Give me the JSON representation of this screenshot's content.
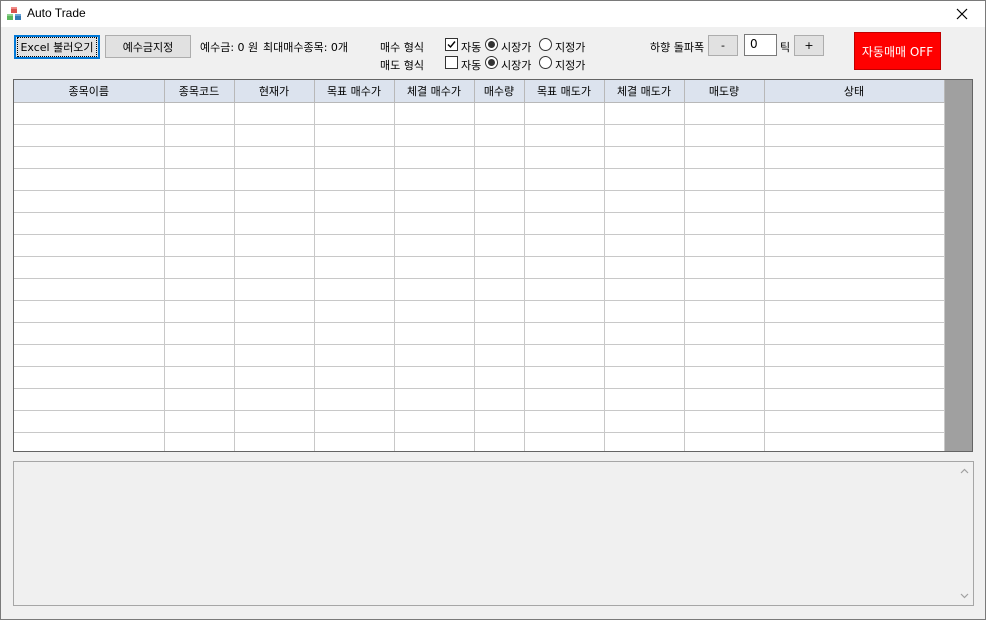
{
  "window": {
    "title": "Auto Trade",
    "app_icon": "cubes-icon",
    "close_icon": "close-icon"
  },
  "toolbar": {
    "excel_load_label": "Excel 불러오기",
    "deposit_set_label": "예수금지정",
    "deposit_info": "예수금: 0 원",
    "max_stocks_info": "최대매수종목: 0개",
    "buy_type_label": "매수 형식",
    "sell_type_label": "매도 형식",
    "auto_label": "자동",
    "market_price_label": "시장가",
    "limit_price_label": "지정가",
    "buy_auto_checked": true,
    "sell_auto_checked": false,
    "buy_price_mode": "시장가",
    "sell_price_mode": "시장가",
    "drop_breakout_label": "하향 돌파폭",
    "minus_label": "-",
    "tick_value": "0",
    "tick_unit": "틱",
    "plus_label": "+",
    "auto_trade_toggle_label": "자동매매 OFF",
    "auto_trade_toggle_color": "#ff0000"
  },
  "grid": {
    "columns": [
      "종목이름",
      "종목코드",
      "현재가",
      "목표 매수가",
      "체결 매수가",
      "매수량",
      "목표 매도가",
      "체결 매도가",
      "매도량",
      "상태"
    ],
    "rows": [],
    "header_color": "#dce3ee"
  },
  "log": {
    "text": ""
  }
}
